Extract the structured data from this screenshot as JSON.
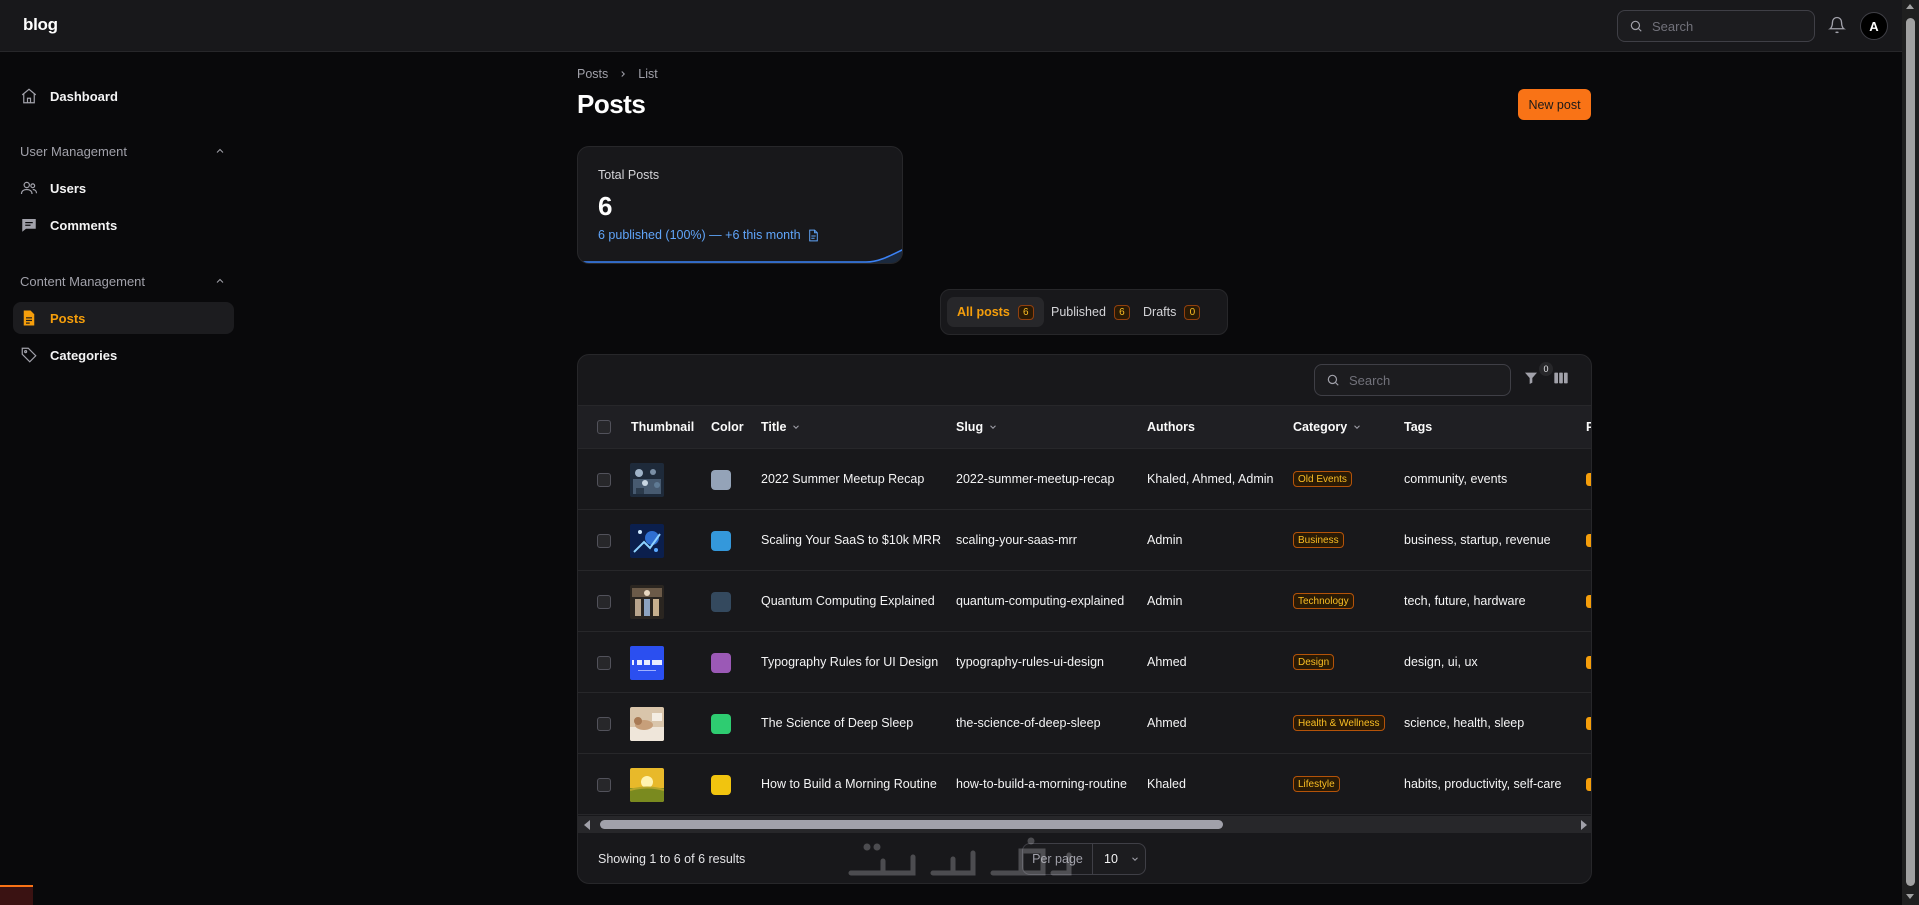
{
  "app": {
    "brand": "blog"
  },
  "topbar": {
    "search_placeholder": "Search",
    "avatar_initial": "A"
  },
  "sidebar": {
    "dashboard": "Dashboard",
    "groups": [
      {
        "label": "User Management",
        "items": [
          "Users",
          "Comments"
        ]
      },
      {
        "label": "Content Management",
        "items": [
          "Posts",
          "Categories"
        ]
      }
    ],
    "active_item": "Posts"
  },
  "breadcrumb": {
    "root": "Posts",
    "current": "List"
  },
  "page": {
    "title": "Posts",
    "new_button": "New post"
  },
  "stat": {
    "label": "Total Posts",
    "value": "6",
    "description": "6 published (100%) — +6 this month"
  },
  "tabs": [
    {
      "label": "All posts",
      "count": "6"
    },
    {
      "label": "Published",
      "count": "6"
    },
    {
      "label": "Drafts",
      "count": "0"
    }
  ],
  "table": {
    "search_placeholder": "Search",
    "filter_count": "0",
    "columns": [
      "Thumbnail",
      "Color",
      "Title",
      "Slug",
      "Authors",
      "Category",
      "Tags",
      "P"
    ],
    "rows": [
      {
        "color": "#94a3b8",
        "title": "2022 Summer Meetup Recap",
        "slug": "2022-summer-meetup-recap",
        "authors": "Khaled, Ahmed, Admin",
        "category": "Old Events",
        "tags": "community, events"
      },
      {
        "color": "#3498db",
        "title": "Scaling Your SaaS to $10k MRR",
        "slug": "scaling-your-saas-mrr",
        "authors": "Admin",
        "category": "Business",
        "tags": "business, startup, revenue"
      },
      {
        "color": "#34495e",
        "title": "Quantum Computing Explained",
        "slug": "quantum-computing-explained",
        "authors": "Admin",
        "category": "Technology",
        "tags": "tech, future, hardware"
      },
      {
        "color": "#9b59b6",
        "title": "Typography Rules for UI Design",
        "slug": "typography-rules-ui-design",
        "authors": "Ahmed",
        "category": "Design",
        "tags": "design, ui, ux"
      },
      {
        "color": "#2ecc71",
        "title": "The Science of Deep Sleep",
        "slug": "the-science-of-deep-sleep",
        "authors": "Ahmed",
        "category": "Health & Wellness",
        "tags": "science, health, sleep"
      },
      {
        "color": "#f1c40f",
        "title": "How to Build a Morning Routine",
        "slug": "how-to-build-a-morning-routine",
        "authors": "Khaled",
        "category": "Lifestyle",
        "tags": "habits, productivity, self-care"
      }
    ],
    "footer": "Showing 1 to 6 of 6 results",
    "per_page_label": "Per page",
    "per_page_value": "10"
  }
}
